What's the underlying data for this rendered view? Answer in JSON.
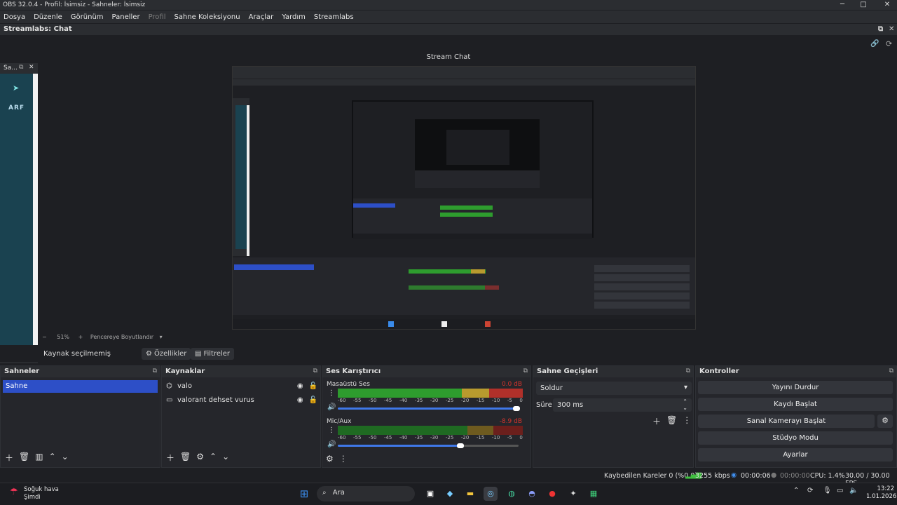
{
  "window": {
    "title": "OBS 32.0.4 - Profil: İsimsiz - Sahneler: İsimsiz",
    "controls": [
      "─",
      "□",
      "✕"
    ]
  },
  "menu": {
    "items": [
      "Dosya",
      "Düzenle",
      "Görünüm",
      "Paneller",
      "Profil",
      "Sahne Koleksiyonu",
      "Araçlar",
      "Yardım",
      "Streamlabs"
    ]
  },
  "dock": {
    "title": "Streamlabs: Chat",
    "chat_title": "Stream Chat",
    "side_label": "Sa...",
    "side_logo": "ARF"
  },
  "preview": {
    "zoom": "51%",
    "zoom_mode": "Pencereye Boyutlandır"
  },
  "source_bar": {
    "no_source": "Kaynak seçilmemiş",
    "properties": "Özellikler",
    "filters": "Filtreler"
  },
  "scenes": {
    "title": "Sahneler",
    "items": [
      "Sahne"
    ]
  },
  "sources": {
    "title": "Kaynaklar",
    "items": [
      "valo",
      "valorant dehset vurus"
    ]
  },
  "mixer": {
    "title": "Ses Karıştırıcı",
    "channels": [
      {
        "name": "Masaüstü Ses",
        "db": "0.0 dB",
        "level": 0.98,
        "volume": 1.0
      },
      {
        "name": "Mic/Aux",
        "db": "-8.9 dB",
        "level": 0.0,
        "volume": 0.66
      }
    ],
    "ticks": [
      "-60",
      "-55",
      "-50",
      "-45",
      "-40",
      "-35",
      "-30",
      "-25",
      "-20",
      "-15",
      "-10",
      "-5",
      "0"
    ]
  },
  "transitions": {
    "title": "Sahne Geçişleri",
    "selected": "Soldur",
    "duration_label": "Süre",
    "duration_value": "300 ms"
  },
  "controls": {
    "title": "Kontroller",
    "buttons": [
      "Yayını Durdur",
      "Kaydı Başlat",
      "Sanal Kamerayı Başlat",
      "Stüdyo Modu",
      "Ayarlar"
    ]
  },
  "status": {
    "dropped": "Kaybedilen Kareler 0 (%0.0)",
    "bitrate": "3255 kbps",
    "stream_time": "00:00:06",
    "rec_time": "00:00:00",
    "cpu": "CPU: 1.4%",
    "fps": "30.00 / 30.00 FPS"
  },
  "taskbar": {
    "weather_title": "Soğuk hava",
    "weather_sub": "Şimdi",
    "search": "Ara",
    "time": "13:22",
    "date": "1.01.2026"
  },
  "colors": {
    "accent": "#2d4fc7",
    "meter_green": "#2e9c2e",
    "meter_yellow": "#b89a2e",
    "meter_red": "#b0302a"
  }
}
